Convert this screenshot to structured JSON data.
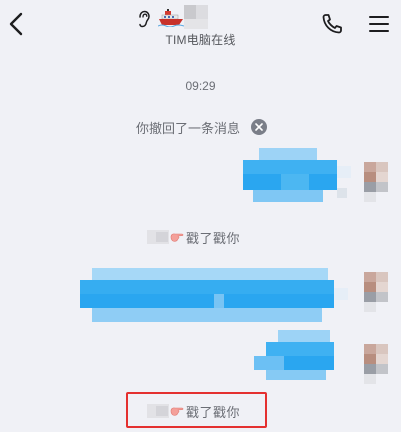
{
  "header": {
    "subtitle": "TIM电脑在线",
    "icons": [
      "back-icon",
      "ear-icon",
      "boat-icon",
      "phone-icon",
      "menu-icon"
    ]
  },
  "chat": {
    "timestamp": "09:29",
    "recall_notice": "你撤回了一条消息",
    "poke_notices": [
      {
        "text": "戳了戳你"
      },
      {
        "text": "戳了戳你"
      }
    ]
  },
  "colors": {
    "background": "#f0f1f6",
    "bubble_blue": "#2aa6f0",
    "highlight_red": "#e4302f"
  }
}
